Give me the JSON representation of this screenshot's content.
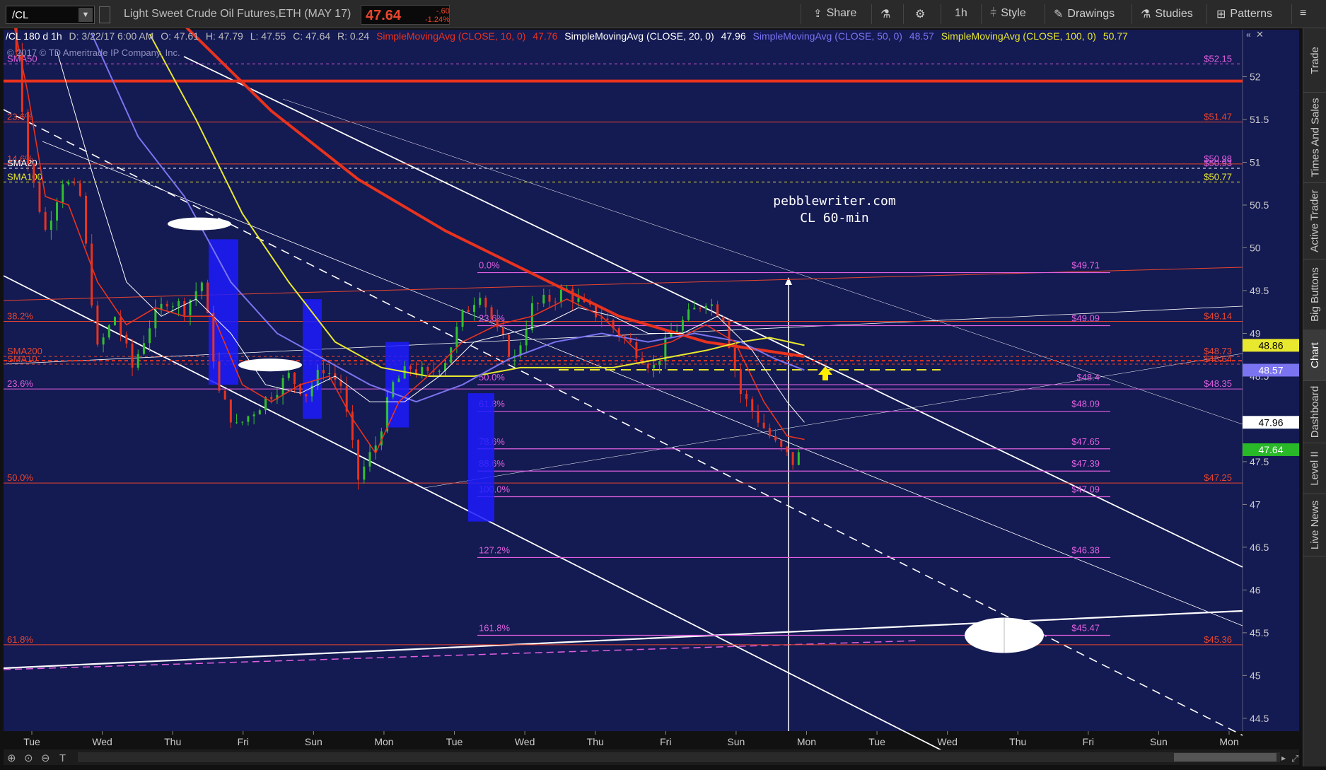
{
  "toolbar": {
    "symbol": "/CL",
    "description": "Light Sweet Crude Oil Futures,ETH (MAY 17)",
    "last": "47.64",
    "change": "-.60",
    "change_pct": "-1.24%",
    "share": "Share",
    "timeframe": "1h",
    "style": "Style",
    "drawings": "Drawings",
    "studies": "Studies",
    "patterns": "Patterns"
  },
  "header": {
    "info": "/CL 180 d 1h",
    "date": "D: 3/22/17 6:00 AM",
    "open": "O: 47.61",
    "high": "H: 47.79",
    "low": "L: 47.55",
    "close": "C: 47.64",
    "range": "R: 0.24",
    "sma10": "SimpleMovingAvg (CLOSE, 10, 0)",
    "sma10_val": "47.76",
    "sma20": "SimpleMovingAvg (CLOSE, 20, 0)",
    "sma20_val": "47.96",
    "sma50": "SimpleMovingAvg (CLOSE, 50, 0)",
    "sma50_val": "48.57",
    "sma100": "SimpleMovingAvg (CLOSE, 100, 0)",
    "sma100_val": "50.77"
  },
  "watermark": "© 2017 © TD Ameritrade IP Company, Inc.",
  "annotation": {
    "line1": "pebblewriter.com",
    "line2": "CL 60-min"
  },
  "colors": {
    "background": "#141a52",
    "sma10": "#e8331e",
    "sma20": "#ffffff",
    "sma50": "#7b74f0",
    "sma100": "#e8e82e",
    "fib": "#e060e0",
    "fib_big": "#e8462d"
  },
  "chart_data": {
    "type": "candlestick",
    "ylim": [
      44.35,
      52.55
    ],
    "yticks": [
      "52",
      "51.5",
      "51",
      "50.5",
      "50",
      "49.5",
      "49",
      "48.5",
      "47.5",
      "47",
      "46.5",
      "46",
      "45.5",
      "45",
      "44.5"
    ],
    "xticks": [
      "Tue",
      "Wed",
      "Thu",
      "Fri",
      "Sun",
      "Mon",
      "Tue",
      "Wed",
      "Thu",
      "Fri",
      "Sun",
      "Mon",
      "Tue",
      "Wed",
      "Thu",
      "Fri",
      "Sun",
      "Mon"
    ],
    "price_tags": [
      {
        "value": 48.86,
        "label": "48.86",
        "bg": "#e8e82e",
        "fg": "#000"
      },
      {
        "value": 48.57,
        "label": "48.57",
        "bg": "#7b74f0",
        "fg": "#fff"
      },
      {
        "value": 47.96,
        "label": "47.96",
        "bg": "#ffffff",
        "fg": "#000"
      },
      {
        "value": 47.64,
        "label": "47.64",
        "bg": "#28b828",
        "fg": "#fff"
      }
    ],
    "left_labels": [
      {
        "value": 52.15,
        "label": "SMA50",
        "color": "#e060e0"
      },
      {
        "value": 51.47,
        "label": "23.6%",
        "color": "#e8462d"
      },
      {
        "value": 50.98,
        "label": "14.6%",
        "color": "#e8462d"
      },
      {
        "value": 50.93,
        "label": "SMA20",
        "color": "#ffffff"
      },
      {
        "value": 50.77,
        "label": "SMA100",
        "color": "#e8e82e"
      },
      {
        "value": 49.14,
        "label": "38.2%",
        "color": "#e8462d"
      },
      {
        "value": 48.73,
        "label": "SMA200",
        "color": "#e8462d"
      },
      {
        "value": 48.64,
        "label": "SMA10",
        "color": "#e8462d"
      },
      {
        "value": 48.35,
        "label": "23.6%",
        "color": "#e060e0"
      },
      {
        "value": 47.25,
        "label": "50.0%",
        "color": "#e8462d"
      },
      {
        "value": 45.36,
        "label": "61.8%",
        "color": "#e8462d"
      }
    ],
    "right_labels": [
      {
        "value": 52.15,
        "label": "$52.15",
        "color": "#e060e0"
      },
      {
        "value": 51.47,
        "label": "$51.47",
        "color": "#e8462d"
      },
      {
        "value": 50.98,
        "label": "$50.98",
        "color": "#e060e0"
      },
      {
        "value": 50.93,
        "label": "$50.93",
        "color": "#e060e0"
      },
      {
        "value": 50.77,
        "label": "$50.77",
        "color": "#e8e82e"
      },
      {
        "value": 49.14,
        "label": "$49.14",
        "color": "#e8462d"
      },
      {
        "value": 48.73,
        "label": "$48.73",
        "color": "#e8462d"
      },
      {
        "value": 48.64,
        "label": "$48.64",
        "color": "#e8462d"
      },
      {
        "value": 48.35,
        "label": "$48.35",
        "color": "#e060e0"
      },
      {
        "value": 47.25,
        "label": "$47.25",
        "color": "#e8462d"
      },
      {
        "value": 45.36,
        "label": "$45.36",
        "color": "#e8462d"
      }
    ],
    "fib_levels": [
      {
        "pct": "0.0%",
        "value": 49.71,
        "label": "$49.71"
      },
      {
        "pct": "23.6%",
        "value": 49.09,
        "label": "$49.09"
      },
      {
        "pct": "50.0%",
        "value": 48.4,
        "label": "$48.4"
      },
      {
        "pct": "61.8%",
        "value": 48.09,
        "label": "$48.09"
      },
      {
        "pct": "78.6%",
        "value": 47.65,
        "label": "$47.65"
      },
      {
        "pct": "88.6%",
        "value": 47.39,
        "label": "$47.39"
      },
      {
        "pct": "100.0%",
        "value": 47.09,
        "label": "$47.09"
      },
      {
        "pct": "127.2%",
        "value": 46.38,
        "label": "$46.38"
      },
      {
        "pct": "161.8%",
        "value": 45.47,
        "label": "$45.47"
      }
    ],
    "price_path": [
      [
        0,
        53.0
      ],
      [
        3,
        51.0
      ],
      [
        6,
        50.2
      ],
      [
        9,
        50.8
      ],
      [
        12,
        50.6
      ],
      [
        15,
        48.8
      ],
      [
        18,
        49.2
      ],
      [
        21,
        48.6
      ],
      [
        24,
        49.1
      ],
      [
        27,
        49.4
      ],
      [
        30,
        49.3
      ],
      [
        33,
        49.6
      ],
      [
        36,
        48.3
      ],
      [
        39,
        47.9
      ],
      [
        42,
        48.1
      ],
      [
        45,
        48.3
      ],
      [
        48,
        48.5
      ],
      [
        51,
        48.3
      ],
      [
        54,
        48.6
      ],
      [
        57,
        48.4
      ],
      [
        60,
        47.3
      ],
      [
        63,
        47.7
      ],
      [
        66,
        48.4
      ],
      [
        69,
        48.6
      ],
      [
        72,
        48.5
      ],
      [
        75,
        48.7
      ],
      [
        78,
        49.2
      ],
      [
        81,
        49.5
      ],
      [
        84,
        49.0
      ],
      [
        87,
        48.7
      ],
      [
        90,
        49.3
      ],
      [
        93,
        49.4
      ],
      [
        96,
        49.5
      ],
      [
        99,
        49.3
      ],
      [
        102,
        49.2
      ],
      [
        105,
        49.0
      ],
      [
        108,
        48.8
      ],
      [
        111,
        48.6
      ],
      [
        114,
        49.0
      ],
      [
        117,
        49.2
      ],
      [
        120,
        49.4
      ],
      [
        123,
        49.2
      ],
      [
        126,
        48.3
      ],
      [
        129,
        48.0
      ],
      [
        132,
        47.7
      ],
      [
        135,
        47.5
      ],
      [
        137,
        47.64
      ]
    ],
    "sma10": [
      [
        0,
        52.8
      ],
      [
        3,
        51.8
      ],
      [
        6,
        50.6
      ],
      [
        10,
        50.5
      ],
      [
        15,
        49.6
      ],
      [
        20,
        49.1
      ],
      [
        25,
        49.3
      ],
      [
        30,
        49.2
      ],
      [
        35,
        49.2
      ],
      [
        40,
        48.4
      ],
      [
        45,
        48.2
      ],
      [
        50,
        48.4
      ],
      [
        55,
        48.5
      ],
      [
        59,
        48.0
      ],
      [
        63,
        47.6
      ],
      [
        67,
        48.2
      ],
      [
        72,
        48.5
      ],
      [
        78,
        48.9
      ],
      [
        84,
        49.1
      ],
      [
        90,
        49.2
      ],
      [
        96,
        49.4
      ],
      [
        102,
        49.2
      ],
      [
        108,
        48.8
      ],
      [
        114,
        48.9
      ],
      [
        120,
        49.1
      ],
      [
        125,
        48.9
      ],
      [
        130,
        48.2
      ],
      [
        134,
        47.8
      ],
      [
        137,
        47.76
      ]
    ],
    "sma20": [
      [
        8,
        52.3
      ],
      [
        14,
        50.9
      ],
      [
        20,
        49.6
      ],
      [
        26,
        49.2
      ],
      [
        32,
        49.4
      ],
      [
        38,
        49.0
      ],
      [
        44,
        48.4
      ],
      [
        50,
        48.3
      ],
      [
        56,
        48.5
      ],
      [
        62,
        48.2
      ],
      [
        68,
        48.2
      ],
      [
        74,
        48.5
      ],
      [
        80,
        48.9
      ],
      [
        86,
        49.0
      ],
      [
        92,
        49.1
      ],
      [
        98,
        49.3
      ],
      [
        104,
        49.2
      ],
      [
        110,
        49.0
      ],
      [
        116,
        49.0
      ],
      [
        122,
        49.2
      ],
      [
        128,
        48.8
      ],
      [
        134,
        48.2
      ],
      [
        137,
        47.96
      ]
    ],
    "sma50": [
      [
        14,
        52.5
      ],
      [
        22,
        51.3
      ],
      [
        30,
        50.6
      ],
      [
        38,
        49.6
      ],
      [
        46,
        49.0
      ],
      [
        54,
        48.7
      ],
      [
        62,
        48.4
      ],
      [
        70,
        48.2
      ],
      [
        78,
        48.4
      ],
      [
        86,
        48.7
      ],
      [
        94,
        48.9
      ],
      [
        102,
        49.0
      ],
      [
        110,
        48.9
      ],
      [
        118,
        49.0
      ],
      [
        126,
        48.9
      ],
      [
        132,
        48.7
      ],
      [
        137,
        48.57
      ]
    ],
    "sma100": [
      [
        24,
        52.5
      ],
      [
        32,
        51.5
      ],
      [
        40,
        50.4
      ],
      [
        48,
        49.6
      ],
      [
        56,
        48.9
      ],
      [
        64,
        48.6
      ],
      [
        72,
        48.5
      ],
      [
        80,
        48.5
      ],
      [
        88,
        48.6
      ],
      [
        96,
        48.6
      ],
      [
        104,
        48.6
      ],
      [
        112,
        48.7
      ],
      [
        120,
        48.8
      ],
      [
        126,
        48.9
      ],
      [
        131,
        48.95
      ],
      [
        137,
        48.86
      ]
    ],
    "sma200": [
      [
        30,
        52.6
      ],
      [
        45,
        51.6
      ],
      [
        60,
        50.8
      ],
      [
        75,
        50.2
      ],
      [
        90,
        49.7
      ],
      [
        105,
        49.2
      ],
      [
        120,
        48.9
      ],
      [
        137,
        48.73
      ]
    ]
  },
  "sidebar": {
    "tabs": [
      "Trade",
      "Times And Sales",
      "Active Trader",
      "Big Buttons",
      "Chart",
      "Dashboard",
      "Level II",
      "Live News"
    ]
  }
}
